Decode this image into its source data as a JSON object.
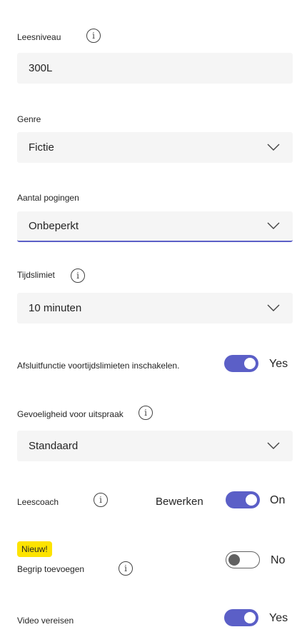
{
  "reading_level": {
    "label": "Leesniveau",
    "value": "300L"
  },
  "genre": {
    "label": "Genre",
    "value": "Fictie"
  },
  "attempts": {
    "label": "Aantal pogingen",
    "value": "Onbeperkt"
  },
  "time_limit": {
    "label": "Tijdslimiet",
    "value": "10 minuten"
  },
  "lock_setting": {
    "label": "Afsluitfunctie voortijdslimieten inschakelen.",
    "state": "Yes"
  },
  "pronunciation": {
    "label": "Gevoeligheid voor uitspraak",
    "value": "Standaard"
  },
  "coach": {
    "label": "Leescoach",
    "edit_label": "Bewerken",
    "state": "On"
  },
  "comprehension": {
    "badge": "Nieuw!",
    "label": "Begrip toevoegen",
    "state": "No"
  },
  "video": {
    "label": "Video vereisen",
    "state": "Yes"
  },
  "colors": {
    "accent": "#5b5fc7",
    "field_bg": "#f5f5f5",
    "badge": "#fde300"
  }
}
